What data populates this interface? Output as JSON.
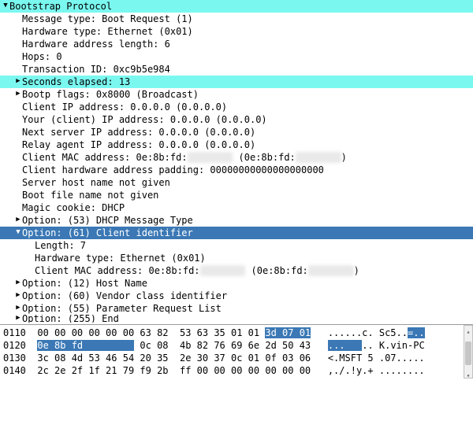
{
  "tree": {
    "root": "Bootstrap Protocol",
    "msg_type": "Message type: Boot Request (1)",
    "hw_type": "Hardware type: Ethernet (0x01)",
    "hw_addr_len": "Hardware address length: 6",
    "hops": "Hops: 0",
    "txn_id": "Transaction ID: 0xc9b5e984",
    "seconds": "Seconds elapsed: 13",
    "bootp_flags": "Bootp flags: 0x8000 (Broadcast)",
    "client_ip": "Client IP address: 0.0.0.0 (0.0.0.0)",
    "your_ip": "Your (client) IP address: 0.0.0.0 (0.0.0.0)",
    "next_server_ip": "Next server IP address: 0.0.0.0 (0.0.0.0)",
    "relay_ip": "Relay agent IP address: 0.0.0.0 (0.0.0.0)",
    "client_mac": "Client MAC address: 0e:8b:fd:         (0e:8b:fd:        )",
    "padding": "Client hardware address padding: 00000000000000000000",
    "server_host": "Server host name not given",
    "boot_file": "Boot file name not given",
    "magic": "Magic cookie: DHCP",
    "opt53": "Option: (53) DHCP Message Type",
    "opt61": "Option: (61) Client identifier",
    "opt61_len": "Length: 7",
    "opt61_hw": "Hardware type: Ethernet (0x01)",
    "opt61_mac": "Client MAC address: 0e:8b:fd:         (0e:8b:fd:        )",
    "opt12": "Option: (12) Host Name",
    "opt60": "Option: (60) Vendor class identifier",
    "opt55": "Option: (55) Parameter Request List",
    "opt255": "Option: (255) End"
  },
  "hex": {
    "r0110": {
      "off": "0110",
      "b": "00 00 00 00 00 00 63 82  53 63 35 01 01 ",
      "sel": "3d 07 01",
      "a_pre": "......c. Sc5..",
      "a_sel": "=.."
    },
    "r0120": {
      "off": "0120",
      "sel": "0e 8b fd         ",
      "b2": " 0c 08  4b 82 76 69 6e 2d 50 43",
      "a_sel": "...   ",
      "a_post": ".. K.vin-PC"
    },
    "r0130": {
      "off": "0130",
      "b": "3c 08 4d 53 46 54 20 35  2e 30 37 0c 01 0f 03 06",
      "a": "<.MSFT 5 .07....."
    },
    "r0140": {
      "off": "0140",
      "b": "2c 2e 2f 1f 21 79 f9 2b  ff 00 00 00 00 00 00 00",
      "a": ",./.!y.+ ........"
    }
  }
}
